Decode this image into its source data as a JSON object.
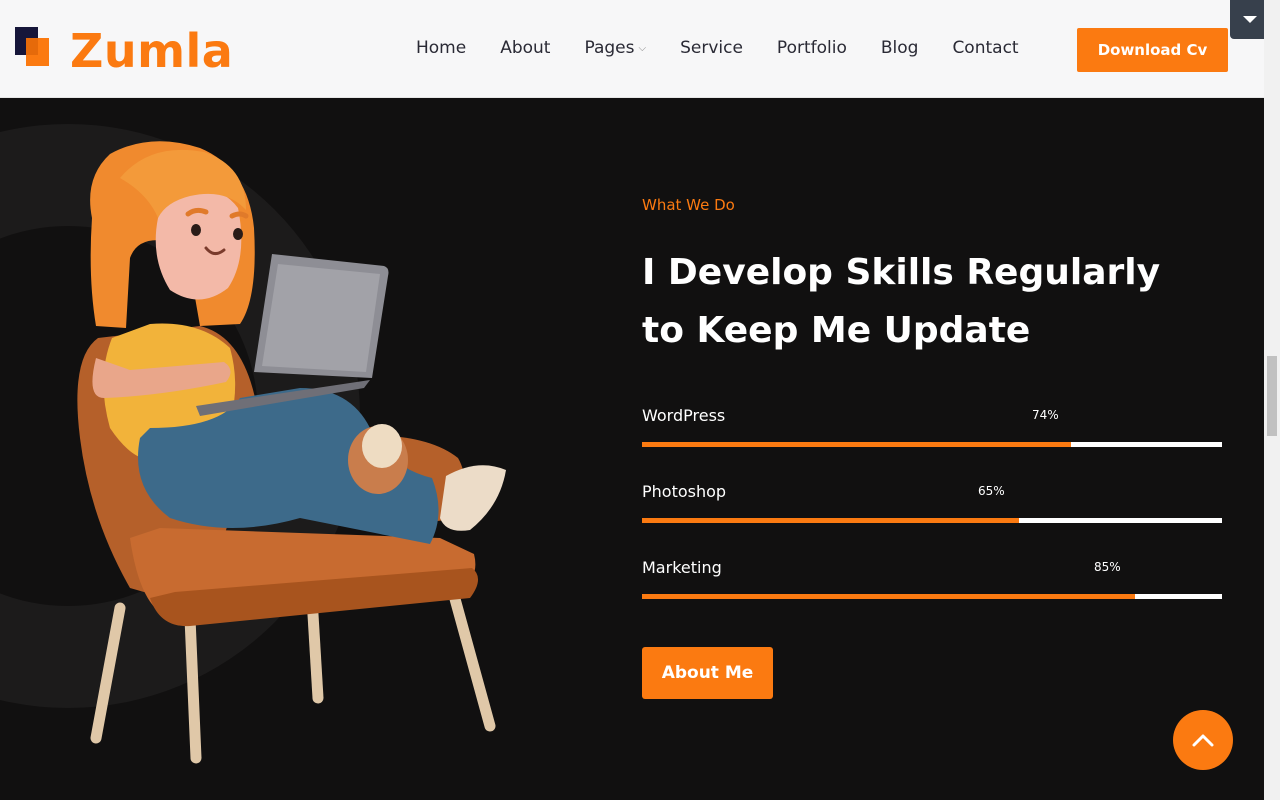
{
  "header": {
    "brand": "Zumla",
    "nav": [
      {
        "label": "Home"
      },
      {
        "label": "About"
      },
      {
        "label": "Pages",
        "has_dropdown": true
      },
      {
        "label": "Service"
      },
      {
        "label": "Portfolio"
      },
      {
        "label": "Blog"
      },
      {
        "label": "Contact"
      }
    ],
    "cta_label": "Download Cv"
  },
  "content": {
    "eyebrow": "What We Do",
    "headline_line1": "I Develop Skills Regularly",
    "headline_line2": "to Keep Me Update",
    "skills": [
      {
        "name": "WordPress",
        "percent_label": "74%",
        "value": 74
      },
      {
        "name": "Photoshop",
        "percent_label": "65%",
        "value": 65
      },
      {
        "name": "Marketing",
        "percent_label": "85%",
        "value": 85
      }
    ],
    "about_button": "About Me"
  },
  "colors": {
    "accent": "#fb7a11",
    "background": "#111010",
    "header_bg": "#f7f7f8",
    "logo_dark": "#16163a"
  },
  "icons": {
    "back_to_top": "chevron-up-icon",
    "corner": "caret-down-icon"
  }
}
